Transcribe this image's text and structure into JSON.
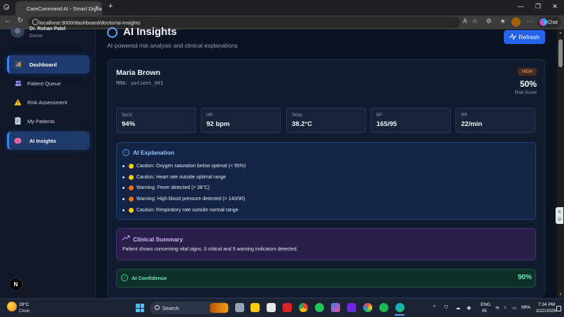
{
  "browser": {
    "tab_title": "CareCommand AI - Smart Digital H",
    "url": "localhost:3000/dashboard/doctor/ai-insights",
    "chat_label": "Chat"
  },
  "user": {
    "name": "Dr. Rohan Patel",
    "role": "Doctor"
  },
  "sidebar": {
    "items": [
      {
        "label": "Dashboard",
        "icon": "chart-icon",
        "active": true
      },
      {
        "label": "Patient Queue",
        "icon": "users-icon",
        "active": false
      },
      {
        "label": "Risk Assessment",
        "icon": "warning-icon",
        "active": false
      },
      {
        "label": "My Patients",
        "icon": "clipboard-icon",
        "active": false
      },
      {
        "label": "AI Insights",
        "icon": "brain-icon",
        "active": true
      }
    ],
    "nx_badge": "N"
  },
  "page": {
    "title": "AI Insights",
    "subtitle": "AI-powered risk analysis and clinical explanations",
    "refresh_label": "Refresh"
  },
  "patient": {
    "name": "Maria Brown",
    "mrn": "MRN: patient_001",
    "risk_level": "HIGH",
    "risk_score": "50%",
    "risk_score_label": "Risk Score",
    "vitals": [
      {
        "label": "SpO2",
        "value": "94%"
      },
      {
        "label": "HR",
        "value": "92 bpm"
      },
      {
        "label": "Temp",
        "value": "38.2°C"
      },
      {
        "label": "BP",
        "value": "165/95"
      },
      {
        "label": "RR",
        "value": "22/min"
      }
    ]
  },
  "explanation": {
    "title": "AI Explanation",
    "items": [
      {
        "severity": "caution",
        "text": "Caution: Oxygen saturation below optimal (< 95%)"
      },
      {
        "severity": "caution",
        "text": "Caution: Heart rate outside optimal range"
      },
      {
        "severity": "warning",
        "text": "Warning: Fever detected (> 38°C)"
      },
      {
        "severity": "warning",
        "text": "Warning: High blood pressure detected (> 140/90)"
      },
      {
        "severity": "caution",
        "text": "Caution: Respiratory rate outside normal range"
      }
    ]
  },
  "summary": {
    "title": "Clinical Summary",
    "text": "Patient shows concerning vital signs. 0 critical and 5 warning indicators detected."
  },
  "confidence": {
    "label": "AI Confidence",
    "value": "90%"
  },
  "taskbar": {
    "weather_temp": "28°C",
    "weather_cond": "Clear",
    "search_placeholder": "Search",
    "lang_top": "ENG",
    "lang_bottom": "IN",
    "battery": "99%",
    "time": "7:34 PM",
    "date": "2/22/2026"
  },
  "colors": {
    "accent": "#2563eb",
    "risk_high": "#fdba74",
    "caution": "#facc15",
    "warning": "#f97316",
    "confidence": "#6ee7b7",
    "summary": "#d8b4fe"
  }
}
